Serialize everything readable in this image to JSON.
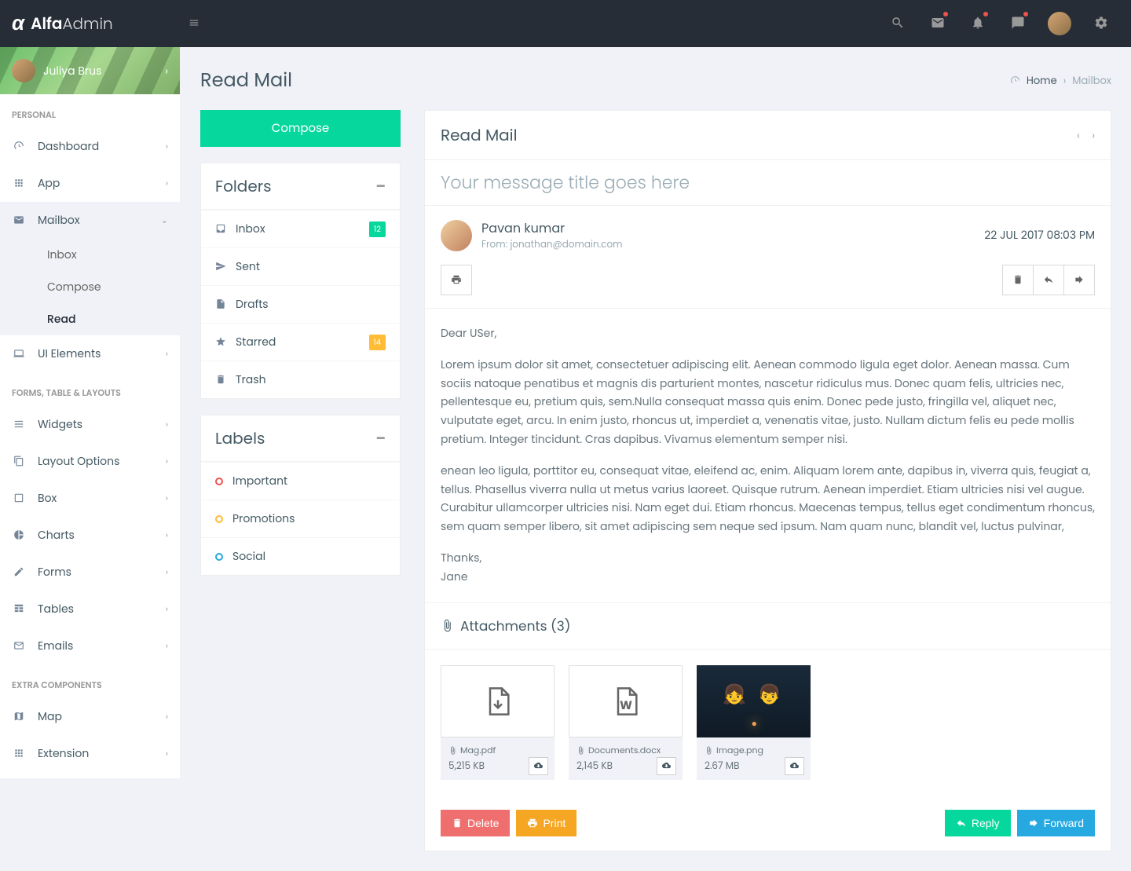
{
  "brand": {
    "bold": "Alfa",
    "light": "Admin"
  },
  "user": {
    "name": "Juliya Brus"
  },
  "sidebar": {
    "section_personal": "PERSONAL",
    "dashboard": "Dashboard",
    "app": "App",
    "mailbox": "Mailbox",
    "mailbox_sub": {
      "inbox": "Inbox",
      "compose": "Compose",
      "read": "Read"
    },
    "ui": "UI Elements",
    "section_forms": "FORMS, TABLE & LAYOUTS",
    "widgets": "Widgets",
    "layout": "Layout Options",
    "box": "Box",
    "charts": "Charts",
    "forms": "Forms",
    "tables": "Tables",
    "emails": "Emails",
    "section_extra": "EXTRA COMPONENTS",
    "map": "Map",
    "extension": "Extension"
  },
  "page": {
    "title": "Read Mail",
    "bc_home": "Home",
    "bc_current": "Mailbox"
  },
  "compose": "Compose",
  "folders": {
    "title": "Folders",
    "inbox": "Inbox",
    "inbox_badge": "12",
    "sent": "Sent",
    "drafts": "Drafts",
    "starred": "Starred",
    "starred_badge": "14",
    "trash": "Trash"
  },
  "labels": {
    "title": "Labels",
    "important": "Important",
    "promotions": "Promotions",
    "social": "Social"
  },
  "mail": {
    "panel_title": "Read Mail",
    "subject": "Your message title goes here",
    "sender_name": "Pavan kumar",
    "sender_from": "From: jonathan@domain.com",
    "datetime": "22 JUL 2017 08:03 PM",
    "greeting": "Dear USer,",
    "p1": "Lorem ipsum dolor sit amet, consectetuer adipiscing elit. Aenean commodo ligula eget dolor. Aenean massa. Cum sociis natoque penatibus et magnis dis parturient montes, nascetur ridiculus mus. Donec quam felis, ultricies nec, pellentesque eu, pretium quis, sem.Nulla consequat massa quis enim. Donec pede justo, fringilla vel, aliquet nec, vulputate eget, arcu. In enim justo, rhoncus ut, imperdiet a, venenatis vitae, justo. Nullam dictum felis eu pede mollis pretium. Integer tincidunt. Cras dapibus. Vivamus elementum semper nisi.",
    "p2": "enean leo ligula, porttitor eu, consequat vitae, eleifend ac, enim. Aliquam lorem ante, dapibus in, viverra quis, feugiat a, tellus. Phasellus viverra nulla ut metus varius laoreet. Quisque rutrum. Aenean imperdiet. Etiam ultricies nisi vel augue. Curabitur ullamcorper ultricies nisi. Nam eget dui. Etiam rhoncus. Maecenas tempus, tellus eget condimentum rhoncus, sem quam semper libero, sit amet adipiscing sem neque sed ipsum. Nam quam nunc, blandit vel, luctus pulvinar,",
    "thanks": "Thanks,",
    "signature": "Jane",
    "attach_title": "Attachments (3)",
    "attachments": [
      {
        "name": "Mag.pdf",
        "size": "5,215 KB"
      },
      {
        "name": "Documents.docx",
        "size": "2,145 KB"
      },
      {
        "name": "Image.png",
        "size": "2.67 MB"
      }
    ],
    "btn_delete": "Delete",
    "btn_print": "Print",
    "btn_reply": "Reply",
    "btn_forward": "Forward"
  }
}
